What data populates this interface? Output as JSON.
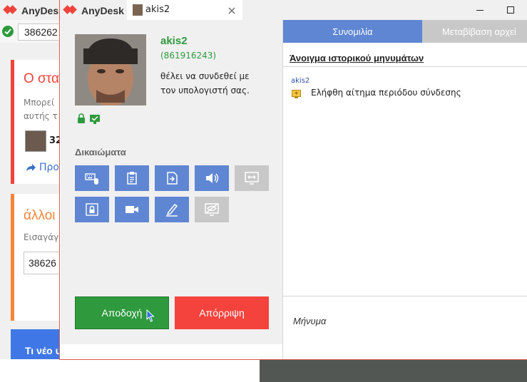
{
  "background_window": {
    "app_name": "AnyDesk",
    "address_partial": "386262",
    "card1": {
      "title_partial": "Ο στα",
      "text_line1": "Μπορεί",
      "text_line2": "αυτής τ",
      "number_partial": "32",
      "link_partial": "Προ"
    },
    "card2": {
      "title_partial": "άλλοι",
      "text_partial": "Εισαγάγ",
      "input_partial": "38626"
    },
    "news_banner": "Τι νέο υπάρχει στο"
  },
  "dialog": {
    "app_name": "AnyDesk",
    "tab_label": "akis2",
    "user": {
      "name": "akis2",
      "id": "(861916243)",
      "request_text_line1": "θέλει να συνδεθεί με",
      "request_text_line2": "τον υπολογιστή σας."
    },
    "permissions_label": "Δικαιώματα",
    "accept_label": "Αποδοχή",
    "reject_label": "Απόρριψη",
    "tabs": {
      "chat": "Συνομιλία",
      "file_transfer": "Μεταβίβαση αρχεί"
    },
    "history_link": "Άνοιγμα ιστορικού μηνυμάτων",
    "chat_entry": {
      "sender": "akis2",
      "message": "Ελήφθη αίτημα περιόδου σύνδεσης"
    },
    "message_placeholder": "Μήνυμα"
  },
  "colors": {
    "accent_blue": "#5f86d3",
    "accept_green": "#2e9a3d",
    "reject_red": "#f4433c",
    "brand_red": "#ef443b",
    "name_green": "#2e9a3d"
  }
}
